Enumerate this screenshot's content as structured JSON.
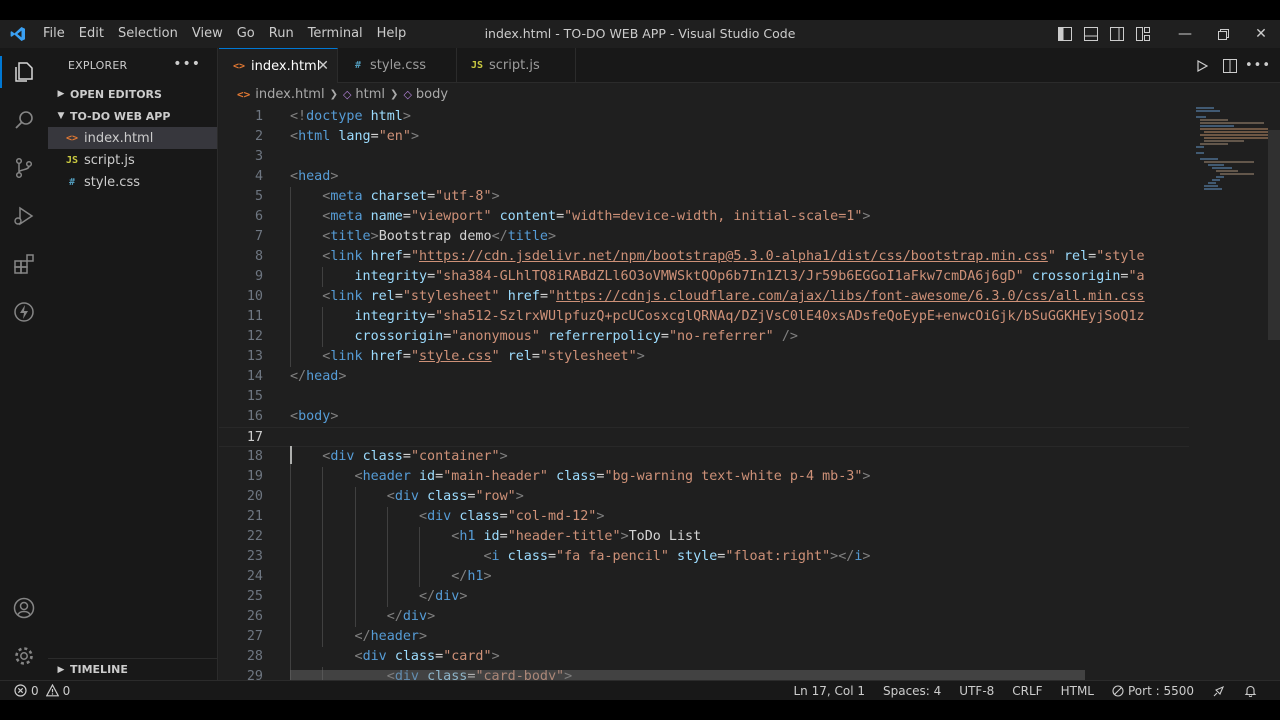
{
  "window": {
    "title": "index.html - TO-DO WEB APP - Visual Studio Code",
    "menu": [
      "File",
      "Edit",
      "Selection",
      "View",
      "Go",
      "Run",
      "Terminal",
      "Help"
    ]
  },
  "sidebar": {
    "title": "EXPLORER",
    "open_editors": "OPEN EDITORS",
    "project": "TO-DO WEB APP",
    "files": [
      {
        "icon": "<>",
        "name": "index.html",
        "color": "#e37933"
      },
      {
        "icon": "JS",
        "name": "script.js",
        "color": "#cbcb41"
      },
      {
        "icon": "#",
        "name": "style.css",
        "color": "#519aba"
      }
    ],
    "timeline": "TIMELINE"
  },
  "tabs": [
    {
      "icon": "<>",
      "label": "index.html",
      "color": "#e37933"
    },
    {
      "icon": "#",
      "label": "style.css",
      "color": "#519aba"
    },
    {
      "icon": "JS",
      "label": "script.js",
      "color": "#cbcb41"
    }
  ],
  "breadcrumb": {
    "file": "index.html",
    "b1": "html",
    "b2": "body"
  },
  "code": {
    "lines": [
      {
        "n": "1",
        "html": "<span class='p'>&lt;!</span><span class='t'>doctype</span> <span class='a'>html</span><span class='p'>&gt;</span>"
      },
      {
        "n": "2",
        "html": "<span class='p'>&lt;</span><span class='t'>html</span> <span class='a'>lang</span>=<span class='s'>\"en\"</span><span class='p'>&gt;</span>"
      },
      {
        "n": "3",
        "html": ""
      },
      {
        "n": "4",
        "html": "<span class='p'>&lt;</span><span class='t'>head</span><span class='p'>&gt;</span>"
      },
      {
        "n": "5",
        "html": "    <span class='p'>&lt;</span><span class='t'>meta</span> <span class='a'>charset</span>=<span class='s'>\"utf-8\"</span><span class='p'>&gt;</span>"
      },
      {
        "n": "6",
        "html": "    <span class='p'>&lt;</span><span class='t'>meta</span> <span class='a'>name</span>=<span class='s'>\"viewport\"</span> <span class='a'>content</span>=<span class='s'>\"width=device-width, initial-scale=1\"</span><span class='p'>&gt;</span>"
      },
      {
        "n": "7",
        "html": "    <span class='p'>&lt;</span><span class='t'>title</span><span class='p'>&gt;</span>Bootstrap demo<span class='p'>&lt;/</span><span class='t'>title</span><span class='p'>&gt;</span>"
      },
      {
        "n": "8",
        "html": "    <span class='p'>&lt;</span><span class='t'>link</span> <span class='a'>href</span>=<span class='s'>\"</span><span class='u'>https://cdn.jsdelivr.net/npm/bootstrap@5.3.0-alpha1/dist/css/bootstrap.min.css</span><span class='s'>\"</span> <span class='a'>rel</span>=<span class='s'>\"style</span>"
      },
      {
        "n": "9",
        "html": "        <span class='a'>integrity</span>=<span class='s'>\"sha384-GLhlTQ8iRABdZLl6O3oVMWSktQOp6b7In1Zl3/Jr59b6EGGoI1aFkw7cmDA6j6gD\"</span> <span class='a'>crossorigin</span>=<span class='s'>\"a</span>"
      },
      {
        "n": "10",
        "html": "    <span class='p'>&lt;</span><span class='t'>link</span> <span class='a'>rel</span>=<span class='s'>\"stylesheet\"</span> <span class='a'>href</span>=<span class='s'>\"</span><span class='u'>https://cdnjs.cloudflare.com/ajax/libs/font-awesome/6.3.0/css/all.min.css</span>"
      },
      {
        "n": "11",
        "html": "        <span class='a'>integrity</span>=<span class='s'>\"sha512-SzlrxWUlpfuzQ+pcUCosxcglQRNAq/DZjVsC0lE40xsADsfeQoEypE+enwcOiGjk/bSuGGKHEyjSoQ1z</span>"
      },
      {
        "n": "12",
        "html": "        <span class='a'>crossorigin</span>=<span class='s'>\"anonymous\"</span> <span class='a'>referrerpolicy</span>=<span class='s'>\"no-referrer\"</span> <span class='p'>/&gt;</span>"
      },
      {
        "n": "13",
        "html": "    <span class='p'>&lt;</span><span class='t'>link</span> <span class='a'>href</span>=<span class='s'>\"</span><span class='u'>style.css</span><span class='s'>\"</span> <span class='a'>rel</span>=<span class='s'>\"stylesheet\"</span><span class='p'>&gt;</span>"
      },
      {
        "n": "14",
        "html": "<span class='p'>&lt;/</span><span class='t'>head</span><span class='p'>&gt;</span>"
      },
      {
        "n": "15",
        "html": ""
      },
      {
        "n": "16",
        "html": "<span class='p'>&lt;</span><span class='t'>body</span><span class='p'>&gt;</span>"
      },
      {
        "n": "17",
        "html": ""
      },
      {
        "n": "18",
        "html": "    <span class='p'>&lt;</span><span class='t'>div</span> <span class='a'>class</span>=<span class='s'>\"container\"</span><span class='p'>&gt;</span>"
      },
      {
        "n": "19",
        "html": "        <span class='p'>&lt;</span><span class='t'>header</span> <span class='a'>id</span>=<span class='s'>\"main-header\"</span> <span class='a'>class</span>=<span class='s'>\"bg-warning text-white p-4 mb-3\"</span><span class='p'>&gt;</span>"
      },
      {
        "n": "20",
        "html": "            <span class='p'>&lt;</span><span class='t'>div</span> <span class='a'>class</span>=<span class='s'>\"row\"</span><span class='p'>&gt;</span>"
      },
      {
        "n": "21",
        "html": "                <span class='p'>&lt;</span><span class='t'>div</span> <span class='a'>class</span>=<span class='s'>\"col-md-12\"</span><span class='p'>&gt;</span>"
      },
      {
        "n": "22",
        "html": "                    <span class='p'>&lt;</span><span class='t'>h1</span> <span class='a'>id</span>=<span class='s'>\"header-title\"</span><span class='p'>&gt;</span>ToDo List"
      },
      {
        "n": "23",
        "html": "                        <span class='p'>&lt;</span><span class='t'>i</span> <span class='a'>class</span>=<span class='s'>\"fa fa-pencil\"</span> <span class='a'>style</span>=<span class='s'>\"float:right\"</span><span class='p'>&gt;&lt;/</span><span class='t'>i</span><span class='p'>&gt;</span>"
      },
      {
        "n": "24",
        "html": "                    <span class='p'>&lt;/</span><span class='t'>h1</span><span class='p'>&gt;</span>"
      },
      {
        "n": "25",
        "html": "                <span class='p'>&lt;/</span><span class='t'>div</span><span class='p'>&gt;</span>"
      },
      {
        "n": "26",
        "html": "            <span class='p'>&lt;/</span><span class='t'>div</span><span class='p'>&gt;</span>"
      },
      {
        "n": "27",
        "html": "        <span class='p'>&lt;/</span><span class='t'>header</span><span class='p'>&gt;</span>"
      },
      {
        "n": "28",
        "html": "        <span class='p'>&lt;</span><span class='t'>div</span> <span class='a'>class</span>=<span class='s'>\"card\"</span><span class='p'>&gt;</span>"
      },
      {
        "n": "29",
        "html": "            <span class='p'>&lt;</span><span class='t'>div</span> <span class='a'>class</span>=<span class='s'>\"card-body\"</span><span class='p'>&gt;</span>"
      }
    ]
  },
  "status": {
    "errors": "0",
    "warnings": "0",
    "position": "Ln 17, Col 1",
    "spaces": "Spaces: 4",
    "encoding": "UTF-8",
    "eol": "CRLF",
    "language": "HTML",
    "port": "Port : 5500"
  }
}
